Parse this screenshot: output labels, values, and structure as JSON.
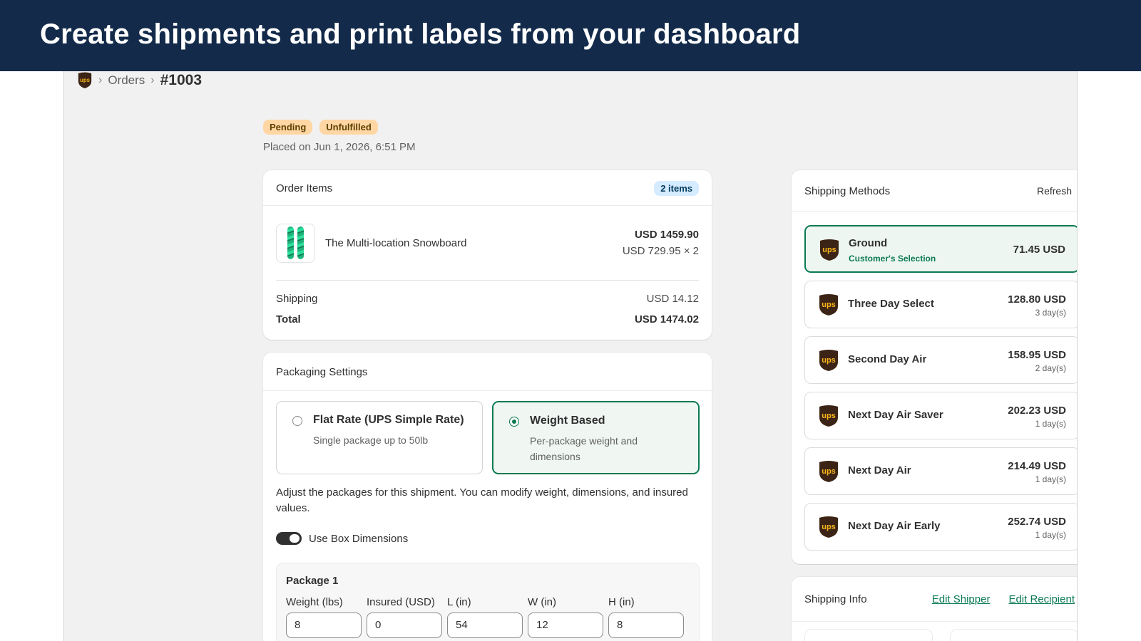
{
  "banner": {
    "title": "Create shipments and print labels from your dashboard"
  },
  "breadcrumb": {
    "sep": "›",
    "orders": "Orders",
    "order_number": "#1003"
  },
  "order": {
    "badges": [
      "Pending",
      "Unfulfilled"
    ],
    "placed": "Placed on Jun 1, 2026, 6:51 PM"
  },
  "order_items": {
    "title": "Order Items",
    "count": "2 items",
    "item": {
      "name": "The Multi-location Snowboard",
      "total": "USD 1459.90",
      "unit": "USD 729.95 × 2"
    },
    "shipping_label": "Shipping",
    "shipping_value": "USD 14.12",
    "total_label": "Total",
    "total_value": "USD 1474.02"
  },
  "packaging": {
    "title": "Packaging Settings",
    "options": [
      {
        "title": "Flat Rate (UPS Simple Rate)",
        "desc": "Single package up to 50lb",
        "selected": false
      },
      {
        "title": "Weight Based",
        "desc": "Per-package weight and dimensions",
        "selected": true
      }
    ],
    "adjust_text": "Adjust the packages for this shipment. You can modify weight, dimensions, and insured values.",
    "toggle_label": "Use Box Dimensions",
    "toggle_on": true,
    "package": {
      "title": "Package 1",
      "fields": [
        {
          "label": "Weight (lbs)",
          "value": "8"
        },
        {
          "label": "Insured (USD)",
          "value": "0"
        },
        {
          "label": "L (in)",
          "value": "54"
        },
        {
          "label": "W (in)",
          "value": "12"
        },
        {
          "label": "H (in)",
          "value": "8"
        }
      ]
    }
  },
  "shipping_methods": {
    "title": "Shipping Methods",
    "refresh": "Refresh",
    "logo_text": "ups",
    "methods": [
      {
        "name": "Ground",
        "subtitle": "Customer's Selection",
        "price": "71.45 USD",
        "days": "",
        "selected": true
      },
      {
        "name": "Three Day Select",
        "subtitle": "",
        "price": "128.80 USD",
        "days": "3 day(s)",
        "selected": false
      },
      {
        "name": "Second Day Air",
        "subtitle": "",
        "price": "158.95 USD",
        "days": "2 day(s)",
        "selected": false
      },
      {
        "name": "Next Day Air Saver",
        "subtitle": "",
        "price": "202.23 USD",
        "days": "1 day(s)",
        "selected": false
      },
      {
        "name": "Next Day Air",
        "subtitle": "",
        "price": "214.49 USD",
        "days": "1 day(s)",
        "selected": false
      },
      {
        "name": "Next Day Air Early",
        "subtitle": "",
        "price": "252.74 USD",
        "days": "1 day(s)",
        "selected": false
      }
    ]
  },
  "shipping_info": {
    "title": "Shipping Info",
    "edit_shipper": "Edit Shipper",
    "edit_recipient": "Edit Recipient"
  },
  "colors": {
    "banner_bg": "#132a4a",
    "accent_green": "#0a7a52",
    "badge_orange": "#ffd6a4",
    "badge_blue": "#d5ebff",
    "ups_brown": "#3b2415",
    "ups_gold": "#fbb619"
  },
  "icons": {
    "brand": "ups-logo-icon",
    "board": "snowboard-thumbnail"
  }
}
